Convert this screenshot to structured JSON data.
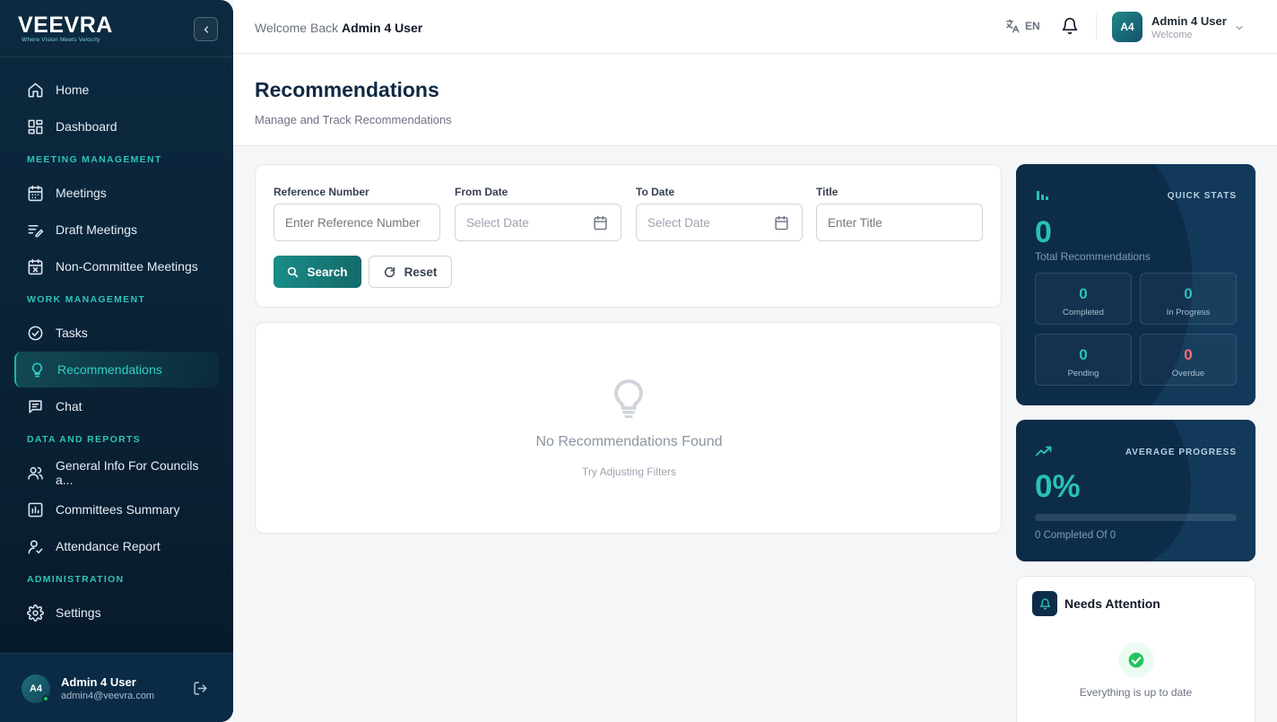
{
  "brand": {
    "name": "VEEVRA",
    "tagline": "Where Vision Meets Velocity"
  },
  "sidebar": {
    "items": [
      {
        "type": "item",
        "label": "Home",
        "icon": "home-icon",
        "name": "sidebar-item-home"
      },
      {
        "type": "item",
        "label": "Dashboard",
        "icon": "dashboard-icon",
        "name": "sidebar-item-dashboard"
      },
      {
        "type": "section",
        "label": "MEETING MANAGEMENT"
      },
      {
        "type": "item",
        "label": "Meetings",
        "icon": "calendar-icon",
        "name": "sidebar-item-meetings"
      },
      {
        "type": "item",
        "label": "Draft Meetings",
        "icon": "draft-icon",
        "name": "sidebar-item-draft-meetings"
      },
      {
        "type": "item",
        "label": "Non-Committee Meetings",
        "icon": "calendar-x-icon",
        "name": "sidebar-item-non-committee-meetings"
      },
      {
        "type": "section",
        "label": "WORK MANAGEMENT"
      },
      {
        "type": "item",
        "label": "Tasks",
        "icon": "check-circle-icon",
        "name": "sidebar-item-tasks"
      },
      {
        "type": "item",
        "label": "Recommendations",
        "icon": "lightbulb-icon",
        "name": "sidebar-item-recommendations",
        "active": true
      },
      {
        "type": "item",
        "label": "Chat",
        "icon": "chat-icon",
        "name": "sidebar-item-chat"
      },
      {
        "type": "section",
        "label": "DATA AND REPORTS"
      },
      {
        "type": "item",
        "label": "General Info For Councils a...",
        "icon": "users-icon",
        "name": "sidebar-item-general-info"
      },
      {
        "type": "item",
        "label": "Committees Summary",
        "icon": "bar-chart-icon",
        "name": "sidebar-item-committees-summary"
      },
      {
        "type": "item",
        "label": "Attendance Report",
        "icon": "user-check-icon",
        "name": "sidebar-item-attendance-report"
      },
      {
        "type": "section",
        "label": "ADMINISTRATION"
      },
      {
        "type": "item",
        "label": "Settings",
        "icon": "gear-icon",
        "name": "sidebar-item-settings"
      }
    ],
    "footer": {
      "initials": "A4",
      "name": "Admin 4 User",
      "email": "admin4@veevra.com"
    }
  },
  "topbar": {
    "welcome_prefix": "Welcome Back",
    "welcome_user": "Admin 4 User",
    "language": "EN",
    "user": {
      "initials": "A4",
      "name": "Admin 4 User",
      "subtitle": "Welcome"
    }
  },
  "page": {
    "title": "Recommendations",
    "subtitle": "Manage and Track Recommendations"
  },
  "filters": {
    "reference": {
      "label": "Reference Number",
      "placeholder": "Enter Reference Number"
    },
    "from_date": {
      "label": "From Date",
      "placeholder": "Select Date"
    },
    "to_date": {
      "label": "To Date",
      "placeholder": "Select Date"
    },
    "title": {
      "label": "Title",
      "placeholder": "Enter Title"
    },
    "search_label": "Search",
    "reset_label": "Reset"
  },
  "empty": {
    "title": "No Recommendations Found",
    "subtitle": "Try Adjusting Filters"
  },
  "quick_stats": {
    "label": "QUICK STATS",
    "total": "0",
    "total_label": "Total Recommendations",
    "completed": "0",
    "completed_label": "Completed",
    "in_progress": "0",
    "in_progress_label": "In Progress",
    "pending": "0",
    "pending_label": "Pending",
    "overdue": "0",
    "overdue_label": "Overdue"
  },
  "average_progress": {
    "label": "AVERAGE PROGRESS",
    "value": "0%",
    "progress": 0,
    "subtitle": "0 Completed Of 0"
  },
  "needs_attention": {
    "title": "Needs Attention",
    "message": "Everything is up to date"
  },
  "colors": {
    "accent": "#29c1b6",
    "sidebar": "#0c2a40",
    "overdue": "#f87171",
    "success": "#22c55e"
  }
}
